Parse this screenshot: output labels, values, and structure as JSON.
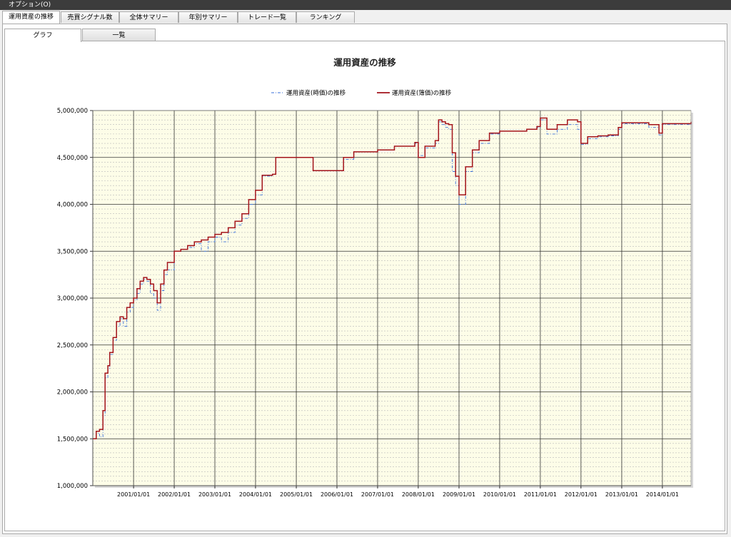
{
  "menu": {
    "options_label": "オプション(O)"
  },
  "top_tabs": [
    {
      "label": "運用資産の推移",
      "active": true
    },
    {
      "label": "売買シグナル数",
      "active": false
    },
    {
      "label": "全体サマリー",
      "active": false
    },
    {
      "label": "年別サマリー",
      "active": false
    },
    {
      "label": "トレード一覧",
      "active": false
    },
    {
      "label": "ランキング",
      "active": false
    }
  ],
  "sub_tabs": [
    {
      "label": "グラフ",
      "active": true
    },
    {
      "label": "一覧",
      "active": false
    }
  ],
  "chart_data": {
    "type": "line",
    "title": "運用資産の推移",
    "xlabel": "",
    "ylabel": "",
    "ylim": [
      1000000,
      5000000
    ],
    "xlim": [
      "2000/01/01",
      "2014/09/15"
    ],
    "y_ticks": [
      "1,000,000",
      "1,500,000",
      "2,000,000",
      "2,500,000",
      "3,000,000",
      "3,500,000",
      "4,000,000",
      "4,500,000",
      "5,000,000"
    ],
    "x_ticks": [
      "2001/01/01",
      "2002/01/01",
      "2003/01/01",
      "2004/01/01",
      "2005/01/01",
      "2006/01/01",
      "2007/01/01",
      "2008/01/01",
      "2009/01/01",
      "2010/01/01",
      "2011/01/01",
      "2012/01/01",
      "2013/01/01",
      "2014/01/01"
    ],
    "grid": true,
    "legend_position": "top-center",
    "background_color": "#fdfde8",
    "series": [
      {
        "name": "運用資産(時価)の推移",
        "color": "#3a6fd8",
        "style": "dash-dot",
        "x": [
          "2000/01/01",
          "2000/02/01",
          "2000/03/01",
          "2000/04/01",
          "2000/04/20",
          "2000/05/15",
          "2000/06/01",
          "2000/07/01",
          "2000/08/01",
          "2000/09/01",
          "2000/10/01",
          "2000/11/01",
          "2000/12/01",
          "2001/01/01",
          "2001/02/01",
          "2001/03/01",
          "2001/04/01",
          "2001/05/01",
          "2001/06/01",
          "2001/07/01",
          "2001/08/01",
          "2001/09/01",
          "2001/10/01",
          "2001/11/01",
          "2002/01/01",
          "2002/03/01",
          "2002/05/01",
          "2002/07/01",
          "2002/09/01",
          "2002/11/01",
          "2003/01/01",
          "2003/03/01",
          "2003/05/01",
          "2003/07/01",
          "2003/09/01",
          "2003/11/01",
          "2004/01/01",
          "2004/03/01",
          "2004/06/01",
          "2004/07/01",
          "2005/06/01",
          "2005/09/01",
          "2006/01/01",
          "2006/03/01",
          "2006/06/01",
          "2007/01/01",
          "2007/06/01",
          "2007/09/01",
          "2007/12/01",
          "2008/01/01",
          "2008/03/01",
          "2008/06/01",
          "2008/07/01",
          "2008/08/01",
          "2008/09/01",
          "2008/10/01",
          "2008/11/01",
          "2008/12/01",
          "2009/01/01",
          "2009/03/01",
          "2009/05/01",
          "2009/07/01",
          "2009/10/01",
          "2010/01/01",
          "2010/06/01",
          "2010/09/01",
          "2010/12/01",
          "2011/01/01",
          "2011/03/01",
          "2011/06/01",
          "2011/09/01",
          "2011/12/01",
          "2012/01/01",
          "2012/03/01",
          "2012/06/01",
          "2012/09/01",
          "2012/12/01",
          "2013/01/01",
          "2013/06/01",
          "2013/09/01",
          "2013/12/01",
          "2014/01/01",
          "2014/04/01",
          "2014/07/01",
          "2014/09/15"
        ],
        "values": [
          1500000,
          1560000,
          1520000,
          1750000,
          2150000,
          2250000,
          2400000,
          2550000,
          2700000,
          2780000,
          2700000,
          2850000,
          2900000,
          2980000,
          3050000,
          3150000,
          3200000,
          3180000,
          3050000,
          3000000,
          2870000,
          3080000,
          3250000,
          3300000,
          3500000,
          3520000,
          3540000,
          3580000,
          3500000,
          3600000,
          3650000,
          3600000,
          3700000,
          3780000,
          3850000,
          4000000,
          4100000,
          4300000,
          4320000,
          4500000,
          4360000,
          4360000,
          4360000,
          4480000,
          4560000,
          4580000,
          4620000,
          4620000,
          4650000,
          4520000,
          4600000,
          4650000,
          4880000,
          4850000,
          4820000,
          4800000,
          4350000,
          4200000,
          4000000,
          4350000,
          4550000,
          4650000,
          4750000,
          4780000,
          4780000,
          4800000,
          4820000,
          4900000,
          4750000,
          4800000,
          4850000,
          4800000,
          4640000,
          4700000,
          4720000,
          4730000,
          4800000,
          4860000,
          4860000,
          4820000,
          4740000,
          4850000,
          4850000,
          4850000,
          4860000
        ]
      },
      {
        "name": "運用資産(簿価)の推移",
        "color": "#a3131b",
        "style": "solid",
        "x": [
          "2000/01/01",
          "2000/02/01",
          "2000/03/01",
          "2000/04/01",
          "2000/04/20",
          "2000/05/15",
          "2000/06/01",
          "2000/07/01",
          "2000/08/01",
          "2000/09/01",
          "2000/10/01",
          "2000/11/01",
          "2000/12/01",
          "2001/01/01",
          "2001/02/01",
          "2001/03/01",
          "2001/04/01",
          "2001/05/01",
          "2001/06/01",
          "2001/07/01",
          "2001/08/01",
          "2001/09/01",
          "2001/10/01",
          "2001/11/01",
          "2002/01/01",
          "2002/03/01",
          "2002/05/01",
          "2002/07/01",
          "2002/09/01",
          "2002/11/01",
          "2003/01/01",
          "2003/03/01",
          "2003/05/01",
          "2003/07/01",
          "2003/09/01",
          "2003/11/01",
          "2004/01/01",
          "2004/03/01",
          "2004/06/01",
          "2004/07/01",
          "2005/06/01",
          "2005/09/01",
          "2006/01/01",
          "2006/03/01",
          "2006/06/01",
          "2007/01/01",
          "2007/06/01",
          "2007/09/01",
          "2007/12/01",
          "2008/01/01",
          "2008/03/01",
          "2008/06/01",
          "2008/07/01",
          "2008/08/01",
          "2008/09/01",
          "2008/10/01",
          "2008/11/01",
          "2008/12/01",
          "2009/01/01",
          "2009/03/01",
          "2009/05/01",
          "2009/07/01",
          "2009/10/01",
          "2010/01/01",
          "2010/06/01",
          "2010/09/01",
          "2010/12/01",
          "2011/01/01",
          "2011/03/01",
          "2011/06/01",
          "2011/09/01",
          "2011/12/01",
          "2012/01/01",
          "2012/03/01",
          "2012/06/01",
          "2012/09/01",
          "2012/12/01",
          "2013/01/01",
          "2013/06/01",
          "2013/09/01",
          "2013/12/01",
          "2014/01/01",
          "2014/04/01",
          "2014/07/01",
          "2014/09/15"
        ],
        "values": [
          1500000,
          1580000,
          1600000,
          1800000,
          2200000,
          2280000,
          2420000,
          2580000,
          2750000,
          2800000,
          2780000,
          2900000,
          2950000,
          3000000,
          3100000,
          3180000,
          3220000,
          3200000,
          3150000,
          3080000,
          2950000,
          3150000,
          3300000,
          3380000,
          3500000,
          3520000,
          3560000,
          3600000,
          3620000,
          3650000,
          3680000,
          3700000,
          3750000,
          3820000,
          3900000,
          4050000,
          4150000,
          4310000,
          4320000,
          4500000,
          4360000,
          4360000,
          4360000,
          4500000,
          4560000,
          4580000,
          4620000,
          4620000,
          4660000,
          4500000,
          4620000,
          4680000,
          4900000,
          4880000,
          4860000,
          4850000,
          4550000,
          4300000,
          4100000,
          4400000,
          4580000,
          4680000,
          4760000,
          4780000,
          4780000,
          4800000,
          4830000,
          4920000,
          4800000,
          4850000,
          4900000,
          4880000,
          4650000,
          4720000,
          4730000,
          4740000,
          4820000,
          4870000,
          4870000,
          4850000,
          4760000,
          4860000,
          4860000,
          4860000,
          4880000
        ]
      }
    ]
  }
}
